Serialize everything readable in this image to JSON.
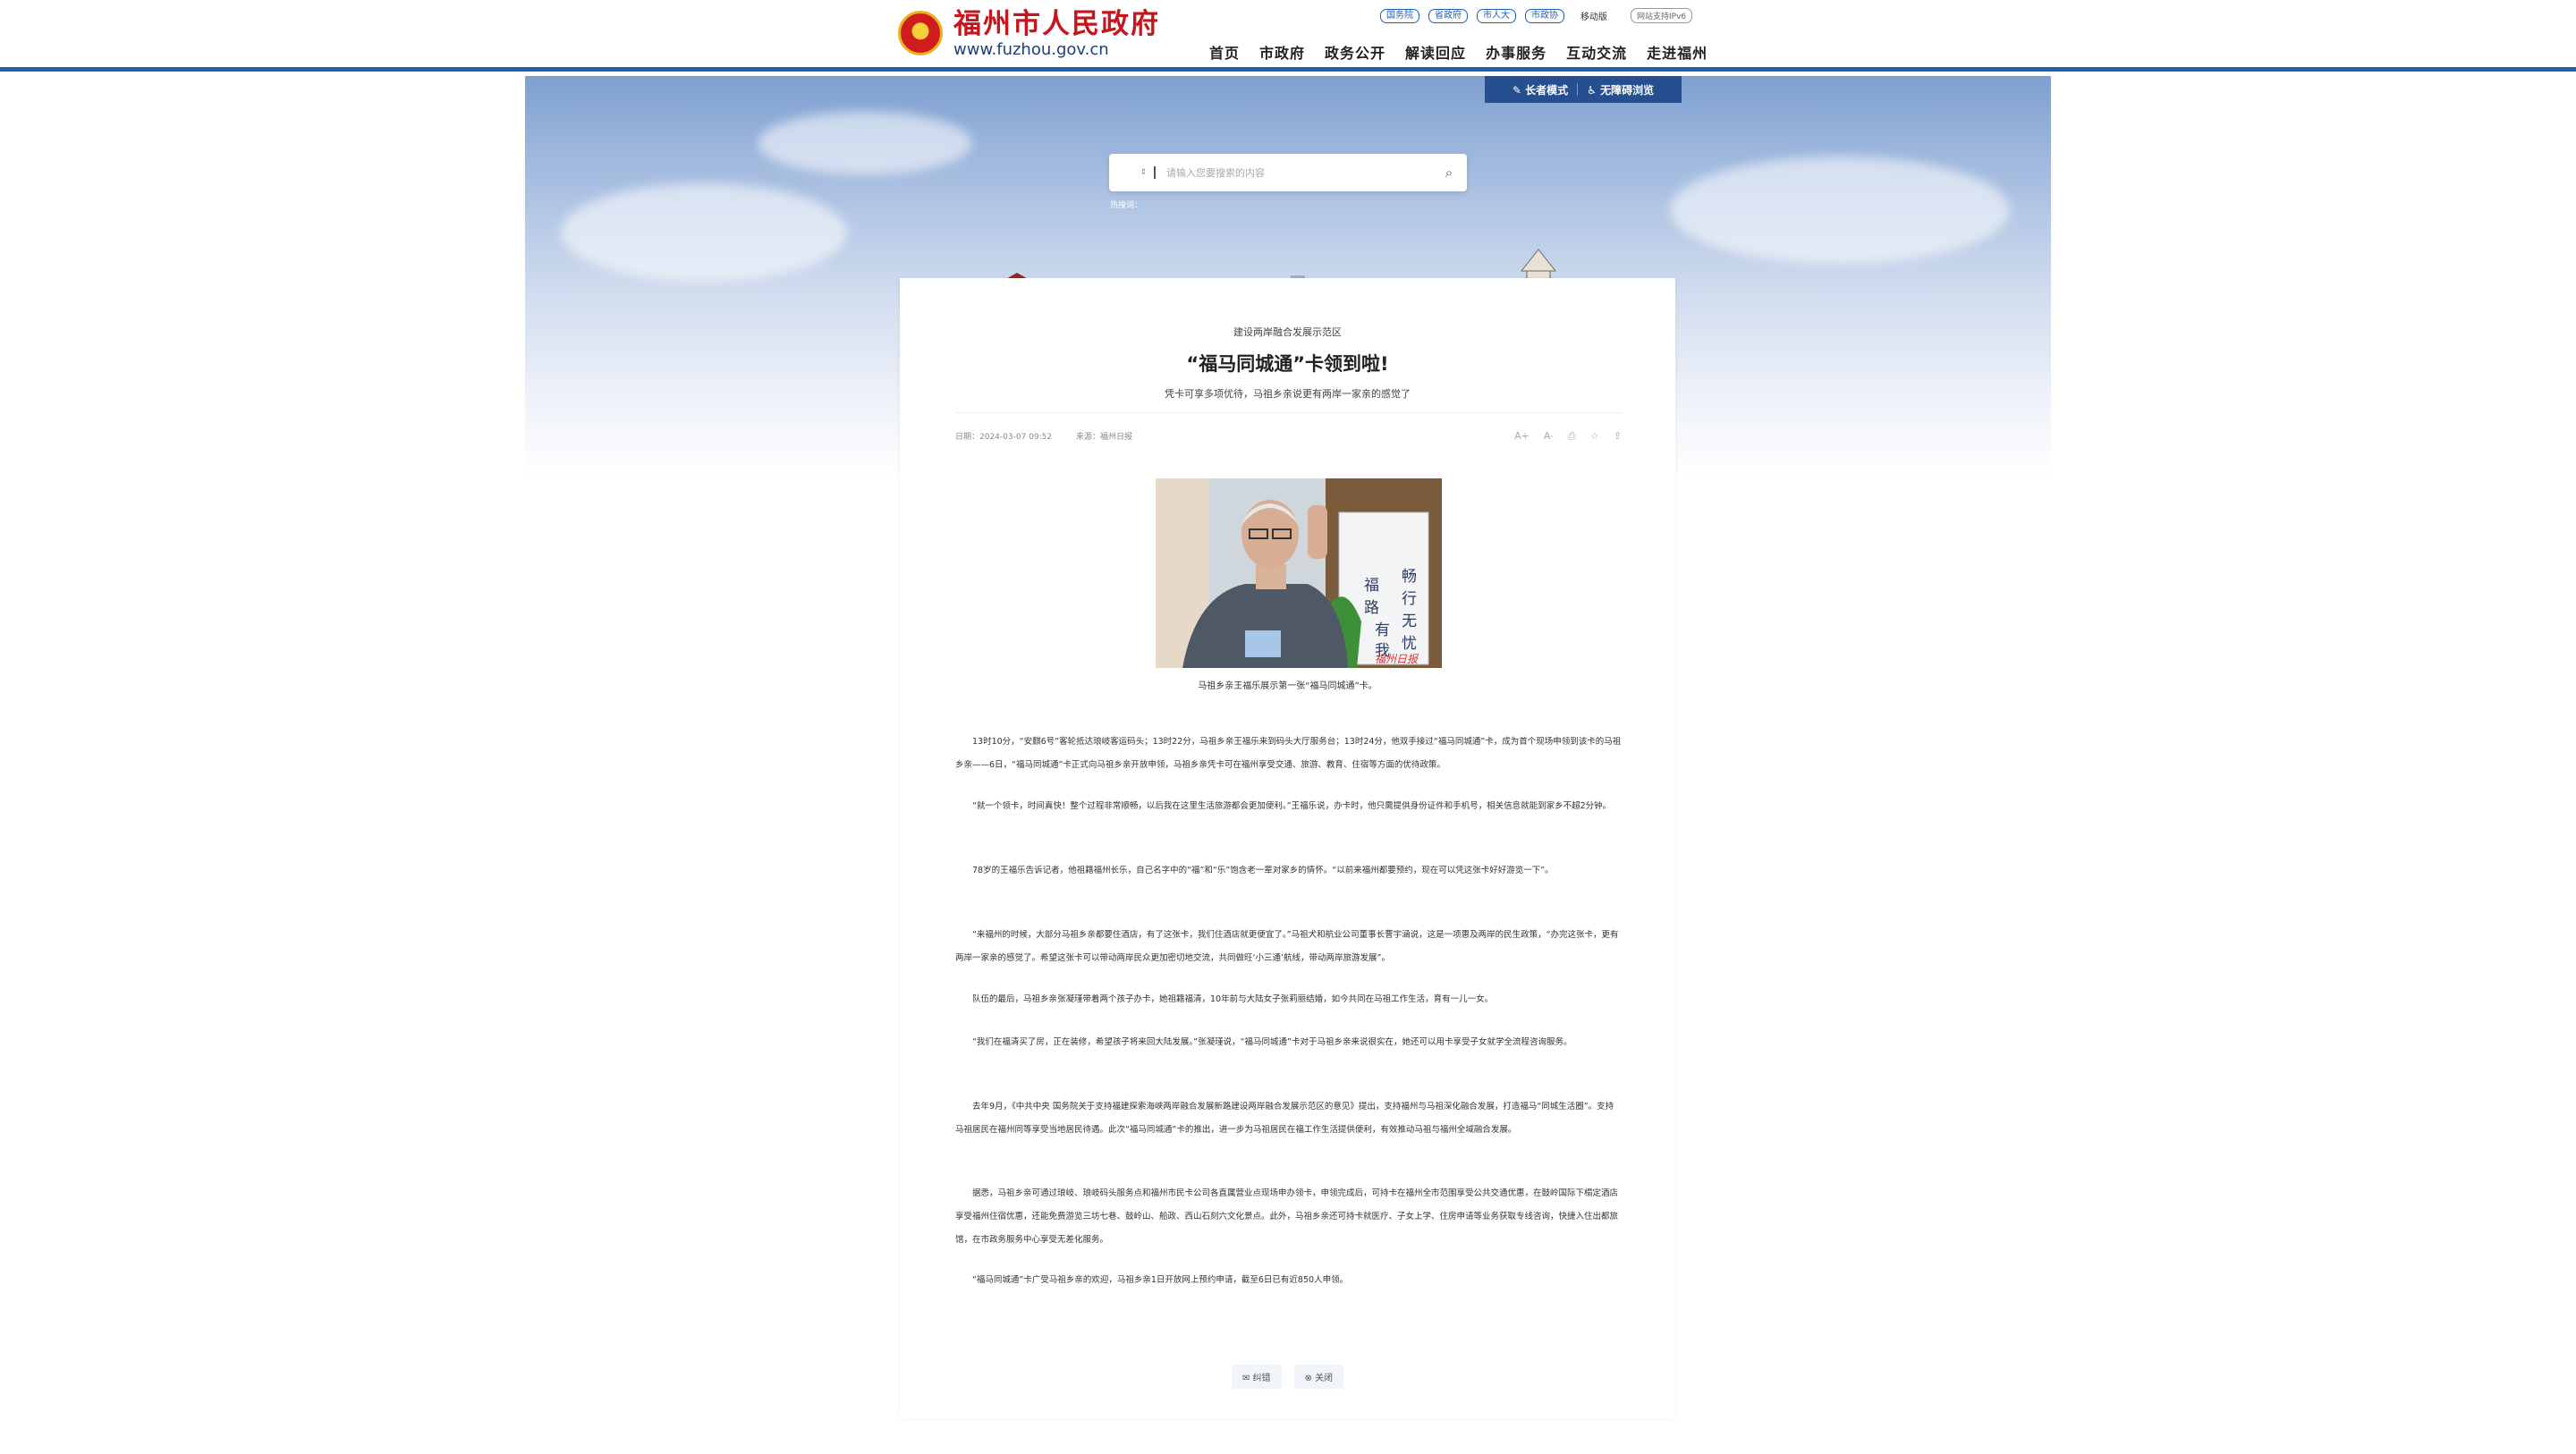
{
  "header": {
    "site_name": "福州市人民政府",
    "site_url": "www.fuzhou.gov.cn",
    "top_links": [
      "国务院",
      "省政府",
      "市人大",
      "市政协"
    ],
    "mobile": "移动版",
    "ipv6": "网站支持IPv6",
    "nav": [
      "首页",
      "市政府",
      "政务公开",
      "解读回应",
      "办事服务",
      "互动交流",
      "走进福州"
    ]
  },
  "modes": {
    "elder": "长者模式",
    "accessible": "无障碍浏览"
  },
  "search": {
    "select": "全部",
    "placeholder": "请输入您要搜索的内容",
    "hot_label": "热搜词："
  },
  "article": {
    "kicker": "建设两岸融合发展示范区",
    "title": "“福马同城通”卡领到啦!",
    "subtitle": "凭卡可享多项优待，马祖乡亲说更有两岸一家亲的感觉了",
    "date": "日期：2024-03-07 09:52",
    "source": "来源：福州日报",
    "tools": [
      "A+",
      "A-",
      "⎙",
      "☆",
      "⇪"
    ],
    "caption": "马祖乡亲王福乐展示第一张“福马同城通”卡。",
    "paragraphs": [
      "13时10分，“安麒6号”客轮抵达琅岐客运码头；13时22分，马祖乡亲王福乐来到码头大厅服务台；13时24分，他双手接过“福马同城通”卡，成为首个现场申领到该卡的马祖乡亲——6日，“福马同城通”卡正式向马祖乡亲开放申领，马祖乡亲凭卡可在福州享受交通、旅游、教育、住宿等方面的优待政策。",
      "“就一个领卡，时间真快！整个过程非常顺畅，以后我在这里生活旅游都会更加便利。”王福乐说，办卡时，他只需提供身份证件和手机号，相关信息就能到家乡不超2分钟。",
      "78岁的王福乐告诉记者，他祖籍福州长乐，自己名字中的“福”和“乐”饱含老一辈对家乡的情怀。“以前来福州都要预约，现在可以凭这张卡好好游览一下”。",
      "“来福州的时候，大部分马祖乡亲都要住酒店，有了这张卡，我们住酒店就更便宜了。”马祖犬和航业公司董事长曹宇涵说，这是一项惠及两岸的民生政策，“办完这张卡，更有两岸一家亲的感觉了。希望这张卡可以带动两岸民众更加密切地交流，共同做旺‘小三通’航线，带动两岸旅游发展”。",
      "队伍的最后，马祖乡亲张凝瑾带着两个孩子办卡，她祖籍福清，10年前与大陆女子张莉丽结婚，如今共同在马祖工作生活，育有一儿一女。",
      "“我们在福清买了房，正在装修，希望孩子将来回大陆发展。”张凝瑾说，“福马同城通”卡对于马祖乡亲来说很实在，她还可以用卡享受子女就学全流程咨询服务。",
      "去年9月，《中共中央 国务院关于支持福建探索海峡两岸融合发展新路建设两岸融合发展示范区的意见》提出，支持福州与马祖深化融合发展，打造福马“同城生活圈”。支持马祖居民在福州同等享受当地居民待遇。此次“福马同城通”卡的推出，进一步为马祖居民在福工作生活提供便利，有效推动马祖与福州全域融合发展。",
      "据悉，马祖乡亲可通过琅岐、琅岐码头服务点和福州市民卡公司各直属营业点现场申办领卡，申领完成后，可持卡在福州全市范围享受公共交通优惠，在鼓岭国际下榻定酒店享受福州住宿优惠，还能免费游览三坊七巷、鼓岭山、船政、西山石刻六文化景点。此外，马祖乡亲还可持卡就医疗、子女上学、住房申请等业务获取专线咨询，快捷入住出都旅馆，在市政务服务中心享受无差化服务。",
      "“福马同城通”卡广受马祖乡亲的欢迎，马祖乡亲1日开放网上预约申请，截至6日已有近850人申领。"
    ],
    "buttons": [
      "纠错",
      "关闭"
    ]
  }
}
